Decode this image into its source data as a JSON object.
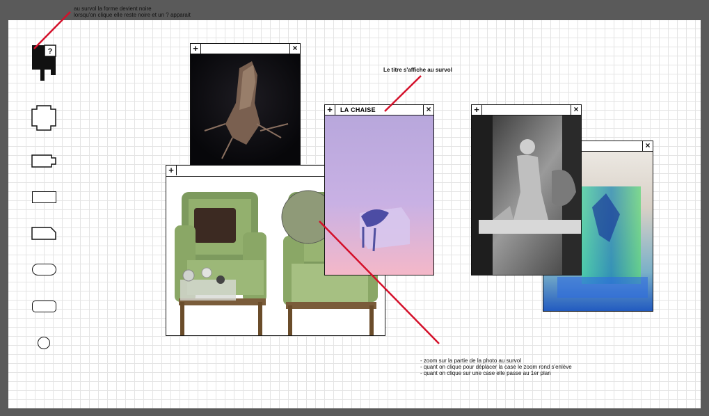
{
  "annotations": {
    "hover_shape_line1": "au survol la forme devient noire",
    "hover_shape_line2": "lorsqu'on clique elle reste noire et un ? apparait",
    "title_hover": "Le titre s'affiche au survol",
    "zoom_line1": "- zoom sur la partie de la photo au survol",
    "zoom_line2": "- quant on clique pour déplacer la case le zoom rond s'enlève",
    "zoom_line3": "- quant on clique sur une case elle passe au 1er plan"
  },
  "toolbar": {
    "question_mark": "?",
    "shapes": [
      "active-shape",
      "cross-shape",
      "battery-shape",
      "rectangle-shape",
      "tag-shape",
      "pill-shape",
      "rounded-rect-shape",
      "circle-shape"
    ]
  },
  "windows": {
    "plus_label": "+",
    "close_label": "×",
    "chair_title": "LA CHAISE"
  },
  "colors": {
    "annotation_line": "#d4102a",
    "border": "#111111",
    "background": "#5a5a5a"
  }
}
